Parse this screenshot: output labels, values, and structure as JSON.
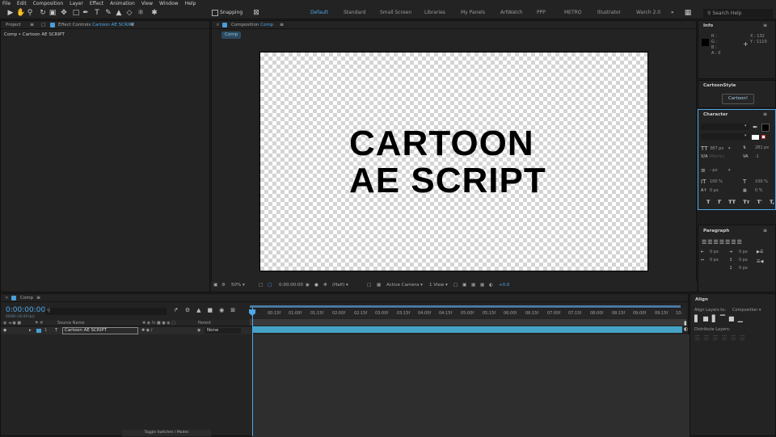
{
  "menu": [
    "File",
    "Edit",
    "Composition",
    "Layer",
    "Effect",
    "Animation",
    "View",
    "Window",
    "Help"
  ],
  "toolbar": {
    "snapping_label": "Snapping",
    "workspaces": [
      "Default",
      "Standard",
      "Small Screen",
      "Libraries",
      "My Panels",
      "ArtWatch",
      "PPP",
      "METRO",
      "Illustrator",
      "Warch 2.0"
    ],
    "active_workspace": "Default",
    "search_placeholder": "Search Help"
  },
  "project_panel": {
    "tab_project": "Project",
    "tab_effect_controls_prefix": "Effect Controls",
    "tab_effect_controls_layer": "Cartoon AE SCRIPT",
    "subtitle": "Comp • Cartoon AE SCRIPT"
  },
  "composition_panel": {
    "tab_prefix": "Composition",
    "tab_name": "Comp",
    "comp_chip": "Comp",
    "canvas_text_line1": "CARTOON",
    "canvas_text_line2": "AE SCRIPT"
  },
  "viewer_bar": {
    "zoom": "50%",
    "timecode": "0:00:00:00",
    "resolution": "(Half)",
    "camera": "Active Camera",
    "views": "1 View",
    "exposure": "+0.0"
  },
  "info_panel": {
    "title": "Info",
    "r": "R :",
    "g": "G :",
    "b": "B :",
    "a": "A : 0",
    "x": "X : 132",
    "y": "Y : 1110"
  },
  "cartoonstyle_panel": {
    "title": "CartoonStyle",
    "button": "Cartoon!"
  },
  "character_panel": {
    "title": "Character",
    "font_size": "387 px",
    "leading": "281 px",
    "tracking": "-1",
    "stroke": "- px",
    "vscale": "100 %",
    "hscale": "100 %",
    "baseline": "0 px",
    "tsume": "0 %",
    "styles": [
      "T",
      "T",
      "TT",
      "Tт",
      "T'",
      "T,"
    ]
  },
  "paragraph_panel": {
    "title": "Paragraph",
    "indent_values": [
      "0 px",
      "0 px",
      "0 px",
      "0 px",
      "0 px"
    ]
  },
  "timeline": {
    "tab": "Comp",
    "timecode": "0:00:00:00",
    "timecode_sub": "00000 (30.00 fps)",
    "col_source": "Source Name",
    "col_parent": "Parent",
    "layer_num": "1",
    "layer_name": "Cartoon AE SCRIPT",
    "parent_value": "None",
    "ruler": [
      "0f",
      "00:15f",
      "01:00f",
      "01:15f",
      "02:00f",
      "02:15f",
      "03:00f",
      "03:15f",
      "04:00f",
      "04:15f",
      "05:00f",
      "05:15f",
      "06:00f",
      "06:15f",
      "07:00f",
      "07:15f",
      "08:00f",
      "08:15f",
      "09:00f",
      "09:15f",
      "10:"
    ],
    "toggle_label": "Toggle Switches / Modes"
  },
  "align_panel": {
    "title": "Align",
    "align_to_label": "Align Layers to:",
    "align_to_value": "Composition",
    "distribute_label": "Distribute Layers:"
  },
  "colors": {
    "accent": "#4ea7e8",
    "layer_bar": "#45a3c7",
    "panel_bg": "#232323"
  }
}
